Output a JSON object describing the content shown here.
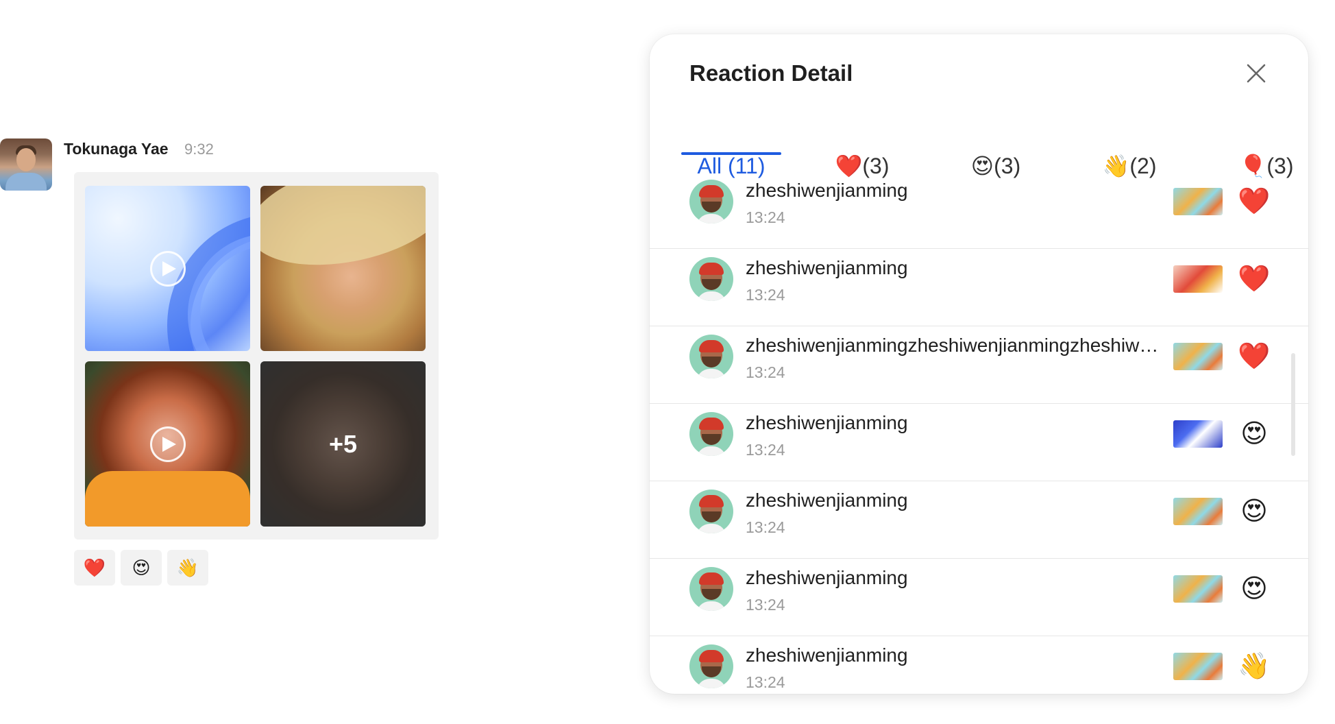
{
  "message": {
    "sender_name": "Tokunaga Yae",
    "time": "9:32",
    "media_more_count": "+5",
    "reactions": [
      "❤️",
      "😍",
      "👋"
    ]
  },
  "panel": {
    "title": "Reaction Detail",
    "tabs": [
      {
        "label": "All (11)",
        "active": true
      },
      {
        "label": "❤️(3)",
        "active": false
      },
      {
        "label": "😍(3)",
        "active": false
      },
      {
        "label": "👋(2)",
        "active": false
      },
      {
        "label": "🎈(3)",
        "active": false
      }
    ],
    "rows": [
      {
        "name": "zheshiwenjianming",
        "time": "13:24",
        "emoji": "❤️"
      },
      {
        "name": "zheshiwenjianming",
        "time": "13:24",
        "emoji": "❤️"
      },
      {
        "name": "zheshiwenjianmingzheshiwenjianmingzheshiwenjianming",
        "time": "13:24",
        "emoji": "❤️"
      },
      {
        "name": "zheshiwenjianming",
        "time": "13:24",
        "emoji": "😍"
      },
      {
        "name": "zheshiwenjianming",
        "time": "13:24",
        "emoji": "😍"
      },
      {
        "name": "zheshiwenjianming",
        "time": "13:24",
        "emoji": "😍"
      },
      {
        "name": "zheshiwenjianming",
        "time": "13:24",
        "emoji": "👋"
      }
    ]
  },
  "colors": {
    "accent": "#1e5be0",
    "muted_text": "#9a9a9a",
    "chip_bg": "#f2f2f2"
  }
}
